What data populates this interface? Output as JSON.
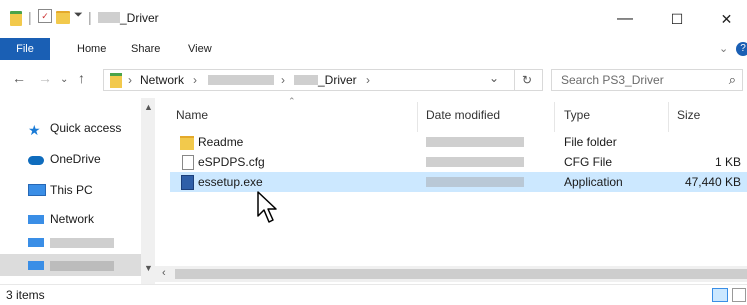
{
  "window": {
    "title": "_Driver",
    "controls": {
      "minimize": "—",
      "maximize": "☐",
      "close": "✕"
    }
  },
  "ribbon": {
    "tabs": [
      "File",
      "Home",
      "Share",
      "View"
    ],
    "expand_icon": "chevron-down",
    "help_icon": "?"
  },
  "address": {
    "crumbs": [
      "Network",
      "_Driver"
    ],
    "separator": "›",
    "dropdown": "⌄",
    "refresh": "↻"
  },
  "search": {
    "placeholder": "Search PS3_Driver"
  },
  "nav_pane": {
    "items": [
      {
        "label": "Quick access",
        "icon": "star-icon"
      },
      {
        "label": "OneDrive",
        "icon": "cloud-icon"
      },
      {
        "label": "This PC",
        "icon": "monitor-icon"
      },
      {
        "label": "Network",
        "icon": "network-icon"
      }
    ]
  },
  "file_list": {
    "columns": [
      "Name",
      "Date modified",
      "Type",
      "Size"
    ],
    "rows": [
      {
        "name": "Readme",
        "type": "File folder",
        "size": "",
        "icon": "folder-icon",
        "selected": false
      },
      {
        "name": "eSPDPS.cfg",
        "type": "CFG File",
        "size": "1 KB",
        "icon": "file-icon",
        "selected": false
      },
      {
        "name": "essetup.exe",
        "type": "Application",
        "size": "47,440 KB",
        "icon": "exe-icon",
        "selected": true
      }
    ]
  },
  "status": {
    "item_count": "3 items"
  },
  "colors": {
    "accent": "#1a5fb4",
    "selection": "#cce8ff",
    "folder": "#f2c94c"
  }
}
